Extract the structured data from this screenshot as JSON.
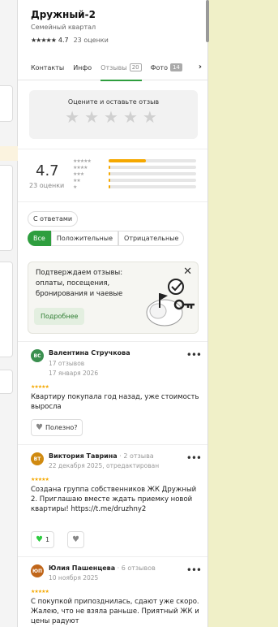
{
  "place": {
    "title": "Дружный-2",
    "subtitle": "Семейный квартал",
    "rating_stars": "★★★★★",
    "rating": "4.7",
    "rating_count": "23 оценки"
  },
  "tabs": [
    {
      "label": "Контакты",
      "badge": ""
    },
    {
      "label": "Инфо",
      "badge": ""
    },
    {
      "label": "Отзывы",
      "badge": "20"
    },
    {
      "label": "Фото",
      "badge": "14"
    }
  ],
  "rate_prompt": {
    "text": "Оцените и оставьте отзыв",
    "stars": "★★★★★"
  },
  "summary": {
    "avg": "4.7",
    "count": "23 оценки",
    "rows": [
      {
        "stars": "★★★★★",
        "fraction": 0.43
      },
      {
        "stars": "★★★★",
        "fraction": 0.02
      },
      {
        "stars": "★★★",
        "fraction": 0.02
      },
      {
        "stars": "★★",
        "fraction": 0.02
      },
      {
        "stars": "★",
        "fraction": 0.02
      }
    ]
  },
  "with_answers": "С ответами",
  "filters": [
    "Все",
    "Положительные",
    "Отрицательные"
  ],
  "banner": {
    "text": "Подтверждаем отзывы: оплаты, посещения, бронирования и чаевые",
    "more": "Подробнее",
    "close": "✕"
  },
  "reviews": [
    {
      "initials": "ВС",
      "color": "#3a8f4f",
      "name": "Валентина Стручкова",
      "count_inline": "",
      "meta1": "17 отзывов",
      "meta2": "17 января 2026",
      "stars": "★★★★★",
      "text": "Квартиру покупала год назад, уже стоимость выросла",
      "helpful": "Полезно?"
    },
    {
      "initials": "ВТ",
      "color": "#d08a10",
      "name": "Виктория Таврина",
      "count_inline": " · 2 отзыва",
      "meta1": "22 декабря 2025, отредактирован",
      "meta2": "",
      "stars": "★★★★★",
      "text": "Создана группа собственников ЖК Дружный 2. Приглашаю вместе ждать приемку новой квартиры! https://t.me/druzhny2",
      "likes": "1"
    },
    {
      "initials": "ЮП",
      "color": "#c0661a",
      "name": "Юлия Пашенцева",
      "count_inline": " · 6 отзывов",
      "meta1": "10 ноября 2025",
      "meta2": "",
      "stars": "★★★★★",
      "text": "С покупкой припозднилась, сдают уже скоро. Жалею, что не взяла раньше. Приятный ЖК и цены радуют"
    }
  ],
  "more_dots": "•••",
  "colors": {
    "accent": "#2e9e3e",
    "star": "#f5a800"
  }
}
